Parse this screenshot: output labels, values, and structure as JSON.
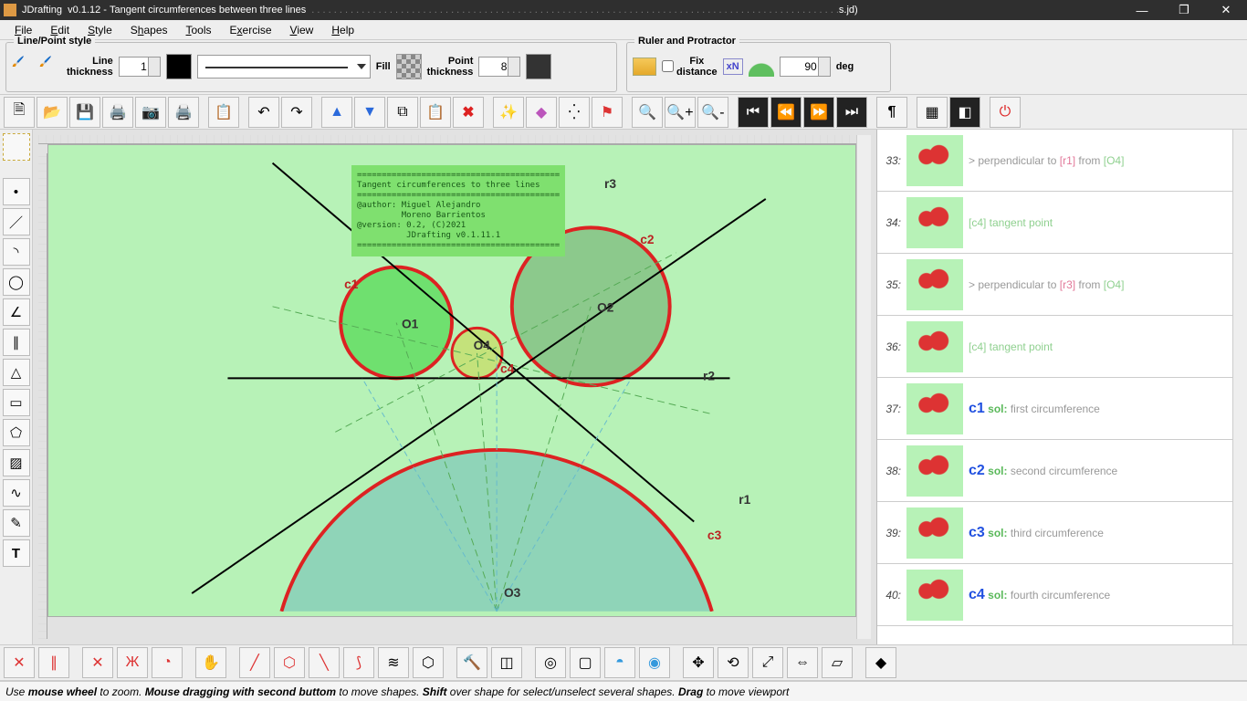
{
  "window": {
    "app": "JDrafting",
    "version": "v0.1.12",
    "doc": "Tangent circumferences between three lines",
    "tail": "s.jd)"
  },
  "menu": [
    "File",
    "Edit",
    "Style",
    "Shapes",
    "Tools",
    "Exercise",
    "View",
    "Help"
  ],
  "panels": {
    "linepoint": {
      "legend": "Line/Point style",
      "thickLabel": "Line\nthickness",
      "thickValue": "1",
      "fillLabel": "Fill",
      "pointLabel": "Point\nthickness",
      "pointValue": "8"
    },
    "ruler": {
      "legend": "Ruler and Protractor",
      "fixLabel": "Fix\ndistance",
      "xnLabel": "xN",
      "angle": "90",
      "deg": "deg"
    }
  },
  "canvas": {
    "infobox": "=========================================\nTangent circumferences to three lines\n=========================================\n@author: Miguel Alejandro\n         Moreno Barrientos\n@version: 0.2, (C)2021\n          JDrafting v0.1.11.1\n=========================================",
    "labels": {
      "c1": "c1",
      "c2": "c2",
      "c3": "c3",
      "O1": "O1",
      "O2": "O2",
      "O3": "O3",
      "O4": "O4",
      "c4": "c4",
      "r1": "r1",
      "r2": "r2",
      "r3": "r3"
    }
  },
  "history": [
    {
      "n": "33",
      "html": "<span class='perp'>&gt; perpendicular to </span><span class='bracket1'>[r1]</span><span class='perp'> from </span><span class='bracket2'>[O4]</span>"
    },
    {
      "n": "34",
      "html": "<span class='bracket2'>[c4]</span><span class='tgt'> tangent point</span>"
    },
    {
      "n": "35",
      "html": "<span class='perp'>&gt; perpendicular to </span><span class='bracket1'>[r3]</span><span class='perp'> from </span><span class='bracket2'>[O4]</span>"
    },
    {
      "n": "36",
      "html": "<span class='bracket2'>[c4]</span><span class='tgt'> tangent point</span>"
    },
    {
      "n": "37",
      "html": "<span class='bigkey'>c1</span> <span class='sol'>sol:</span> <span class='perp'>first circumference</span>"
    },
    {
      "n": "38",
      "html": "<span class='bigkey'>c2</span> <span class='sol'>sol:</span> <span class='perp'>second circumference</span>"
    },
    {
      "n": "39",
      "html": "<span class='bigkey'>c3</span> <span class='sol'>sol:</span> <span class='perp'>third circumference</span>"
    },
    {
      "n": "40",
      "html": "<span class='bigkey'>c4</span> <span class='sol'>sol:</span> <span class='perp'>fourth circumference</span>"
    }
  ],
  "status": "Use <b>mouse wheel</b> to zoom. <b>Mouse dragging with second buttom</b> to move shapes. <b>Shift</b> over shape for select/unselect several shapes. <b>Drag</b> to move viewport"
}
